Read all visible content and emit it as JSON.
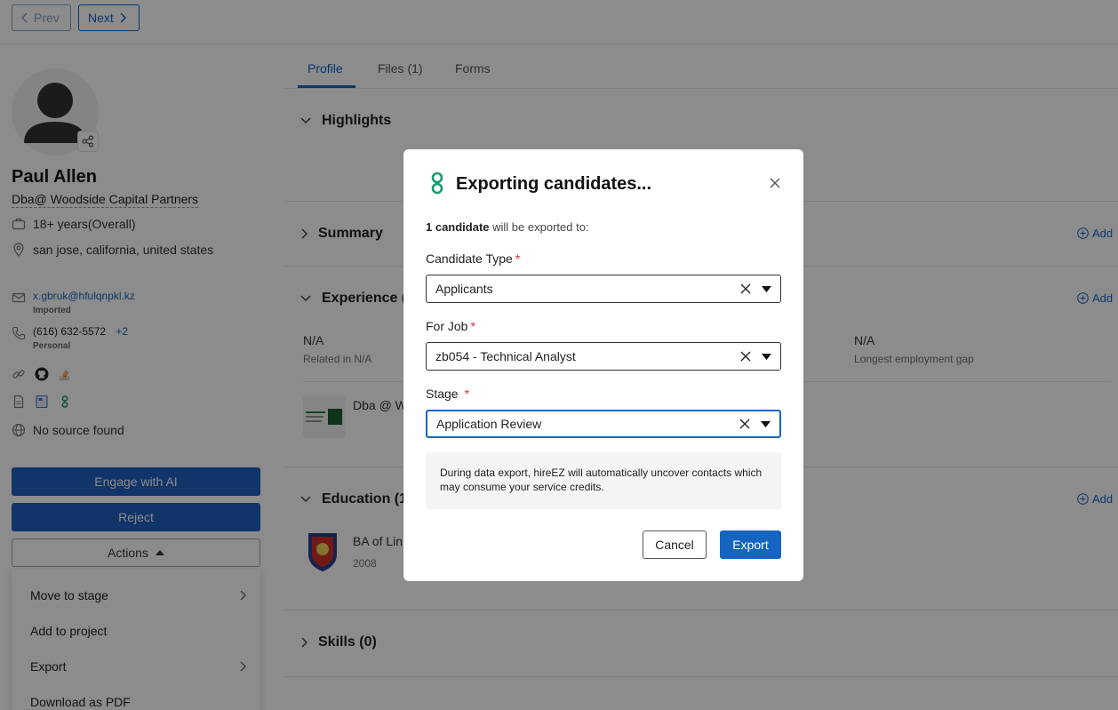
{
  "nav": {
    "prev_label": "Prev",
    "next_label": "Next"
  },
  "profile": {
    "name": "Paul Allen",
    "company": "Dba@ Woodside Capital Partners",
    "experience": "18+ years(Overall)",
    "location": "san jose, california, united states",
    "email": "x.gbruk@hfulqnpkl.kz",
    "email_tag": "Imported",
    "phone": "(616) 632-5572",
    "phone_more": "+2",
    "phone_tag": "Personal",
    "source": "No source found"
  },
  "buttons": {
    "engage": "Engage with AI",
    "reject": "Reject",
    "actions": "Actions"
  },
  "actions_menu": [
    "Move to stage",
    "Add to project",
    "Export",
    "Download as PDF"
  ],
  "tabs": [
    "Profile",
    "Files (1)",
    "Forms"
  ],
  "sections": {
    "highlights": "Highlights",
    "summary": "Summary",
    "experience": "Experience (",
    "education": "Education (1",
    "skills": "Skills (0)",
    "add": "Add"
  },
  "experience_stats": {
    "na1": "N/A",
    "related": "Related in N/A",
    "na2": "N/A",
    "gap": "Longest employment gap",
    "company_partial": "Dba @ W"
  },
  "education": {
    "degree_partial": "BA of Lin",
    "year": "2008"
  },
  "modal": {
    "title": "Exporting candidates...",
    "count_bold": "1 candidate",
    "count_rest": " will be exported to:",
    "candidate_type_label": "Candidate Type",
    "candidate_type_value": "Applicants",
    "job_label": "For Job",
    "job_value": "zb054 - Technical Analyst",
    "stage_label": "Stage",
    "stage_value": "Application Review",
    "note": "During data export, hireEZ will automatically uncover contacts which may consume your service credits.",
    "cancel": "Cancel",
    "export": "Export",
    "required_mark": "*"
  },
  "colors": {
    "accent": "#1565c0",
    "button_blue": "#1f5fbf",
    "brand_green": "#1a9b6c",
    "required": "#d32f2f"
  }
}
